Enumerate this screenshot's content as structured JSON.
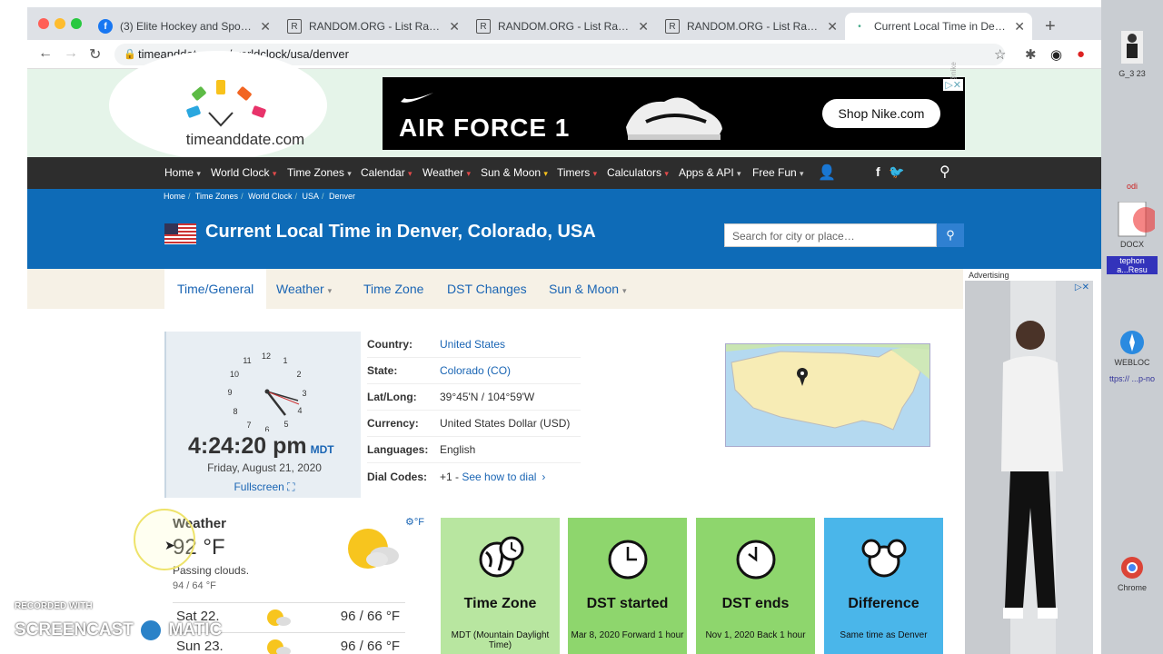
{
  "browser": {
    "tabs": [
      {
        "label": "(3) Elite Hockey and Sportsc",
        "favicon": "f"
      },
      {
        "label": "RANDOM.ORG - List Random",
        "favicon": "R"
      },
      {
        "label": "RANDOM.ORG - List Random",
        "favicon": "R"
      },
      {
        "label": "RANDOM.ORG - List Random",
        "favicon": "R"
      },
      {
        "label": "Current Local Time in Denver",
        "favicon": "•"
      }
    ],
    "url": "timeanddate.com/worldclock/usa/denver"
  },
  "header": {
    "logo_text": "timeanddate.com",
    "ad": {
      "headline": "AIR FORCE 1",
      "brand": "NIKE",
      "cta": "Shop Nike.com",
      "side_text": "@nike"
    }
  },
  "nav": {
    "items": [
      "Home",
      "World Clock",
      "Time Zones",
      "Calendar",
      "Weather",
      "Sun & Moon",
      "Timers",
      "Calculators",
      "Apps & API",
      "Free Fun"
    ]
  },
  "breadcrumb": [
    "Home",
    "Time Zones",
    "World Clock",
    "USA",
    "Denver"
  ],
  "page": {
    "title": "Current Local Time in Denver, Colorado, USA",
    "search_placeholder": "Search for city or place…"
  },
  "subtabs": [
    "Time/General",
    "Weather",
    "Time Zone",
    "DST Changes",
    "Sun & Moon"
  ],
  "clock": {
    "numbers": [
      "12",
      "1",
      "2",
      "3",
      "4",
      "5",
      "6",
      "7",
      "8",
      "9",
      "10",
      "11"
    ],
    "time": "4:24:20 pm",
    "zone": "MDT",
    "date": "Friday, August 21, 2020",
    "fullscreen": "Fullscreen"
  },
  "info": [
    {
      "key": "Country:",
      "value": "United States"
    },
    {
      "key": "State:",
      "value": "Colorado (CO)"
    },
    {
      "key": "Lat/Long:",
      "value": "39°45'N / 104°59'W"
    },
    {
      "key": "Currency:",
      "value": "United States Dollar (USD)"
    },
    {
      "key": "Languages:",
      "value": "English"
    },
    {
      "key": "Dial Codes:",
      "value": "+1 - ",
      "link": "See how to dial"
    }
  ],
  "weather": {
    "title": "Weather",
    "unit": "°F",
    "temp": "92 °F",
    "desc": "Passing clouds.",
    "range": "94 / 64 °F",
    "forecast": [
      {
        "day": "Sat 22.",
        "temps": "96 / 66 °F"
      },
      {
        "day": "Sun 23.",
        "temps": "96 / 66 °F"
      }
    ]
  },
  "tiles": [
    {
      "title": "Time Zone",
      "sub": "MDT (Mountain Daylight Time)",
      "color": "#b8e6a0"
    },
    {
      "title": "DST started",
      "sub": "Mar 8, 2020 Forward 1 hour",
      "color": "#8ed66d"
    },
    {
      "title": "DST ends",
      "sub": "Nov 1, 2020 Back 1 hour",
      "color": "#8ed66d"
    },
    {
      "title": "Difference",
      "sub": "Same time as Denver",
      "color": "#4ab6ea"
    }
  ],
  "side_ad": {
    "label": "Advertising"
  },
  "watermark": {
    "line1": "RECORDED WITH",
    "line2": "SCREENCAST",
    "line3": "MATIC"
  },
  "desktop": [
    "G_3 23",
    "odi",
    "DOCX",
    "tephon a...Resu",
    "WEBLOC",
    "ttps:// ...p-no",
    "Chrome"
  ]
}
